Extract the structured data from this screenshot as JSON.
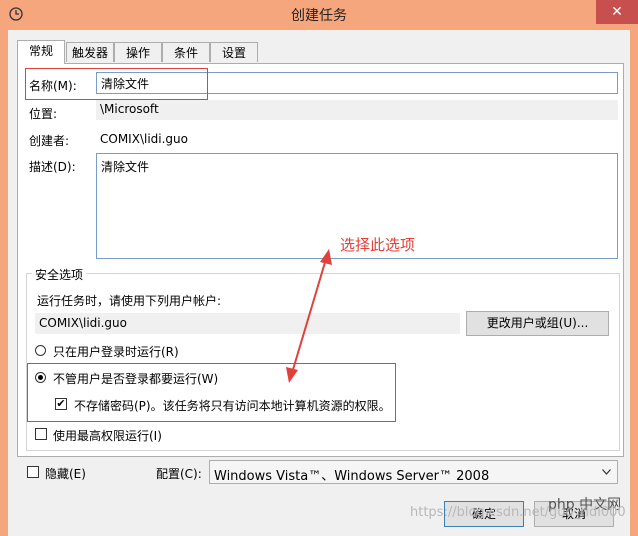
{
  "window": {
    "title": "创建任务",
    "close_glyph": "✕"
  },
  "tabs": [
    {
      "label": "常规",
      "active": true
    },
    {
      "label": "触发器",
      "active": false
    },
    {
      "label": "操作",
      "active": false
    },
    {
      "label": "条件",
      "active": false
    },
    {
      "label": "设置",
      "active": false
    }
  ],
  "general": {
    "name_label": "名称(M):",
    "name_value": "清除文件",
    "location_label": "位置:",
    "location_value": "\\Microsoft",
    "author_label": "创建者:",
    "author_value": "COMIX\\lidi.guo",
    "description_label": "描述(D):",
    "description_value": "清除文件"
  },
  "security": {
    "group_label": "安全选项",
    "run_as_prompt": "运行任务时，请使用下列用户帐户:",
    "account_value": "COMIX\\lidi.guo",
    "change_user_button": "更改用户或组(U)...",
    "option_logged_on": "只在用户登录时运行(R)",
    "option_whether_logged": "不管用户是否登录都要运行(W)",
    "no_store_password": "不存储密码(P)。该任务将只有访问本地计算机资源的权限。",
    "highest_privileges": "使用最高权限运行(I)",
    "selected_option": "option_whether_logged",
    "no_store_password_checked": true,
    "highest_privileges_checked": false
  },
  "footer": {
    "hidden_label": "隐藏(E)",
    "hidden_checked": false,
    "configure_label": "配置(C):",
    "configure_value": "Windows Vista™、Windows Server™ 2008",
    "ok_button": "确定",
    "cancel_button": "取消"
  },
  "annotation": {
    "text": "选择此选项",
    "color": "#e0413a"
  },
  "watermark": {
    "text": "https://blog.csdn.net/guo_ridi000",
    "logo_text": "php 中文网"
  }
}
